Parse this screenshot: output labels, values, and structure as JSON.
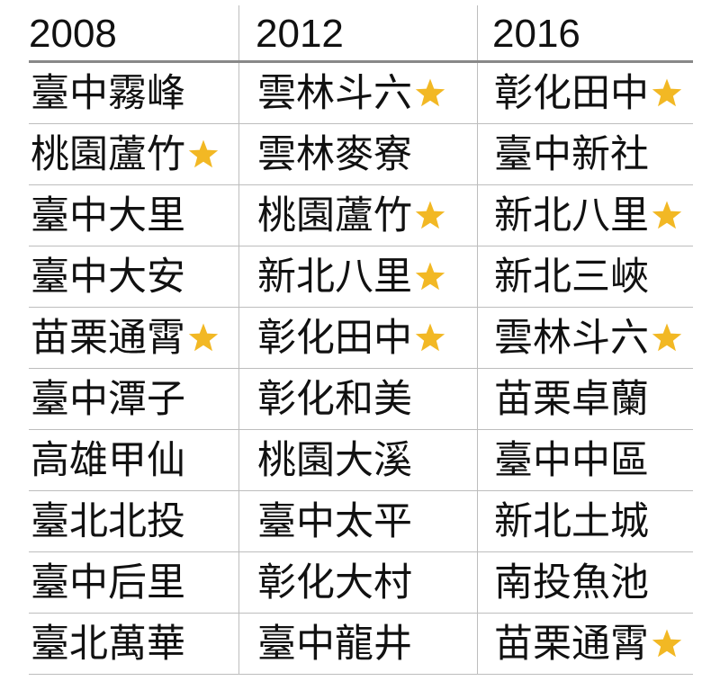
{
  "star_color": "#F2B824",
  "header": [
    "2008",
    "2012",
    "2016"
  ],
  "rows": [
    [
      {
        "text": "臺中霧峰",
        "star": false
      },
      {
        "text": "雲林斗六",
        "star": true
      },
      {
        "text": "彰化田中",
        "star": true
      }
    ],
    [
      {
        "text": "桃園蘆竹",
        "star": true
      },
      {
        "text": "雲林麥寮",
        "star": false
      },
      {
        "text": "臺中新社",
        "star": false
      }
    ],
    [
      {
        "text": "臺中大里",
        "star": false
      },
      {
        "text": "桃園蘆竹",
        "star": true
      },
      {
        "text": "新北八里",
        "star": true
      }
    ],
    [
      {
        "text": "臺中大安",
        "star": false
      },
      {
        "text": "新北八里",
        "star": true
      },
      {
        "text": "新北三峽",
        "star": false
      }
    ],
    [
      {
        "text": "苗栗通霄",
        "star": true
      },
      {
        "text": "彰化田中",
        "star": true
      },
      {
        "text": "雲林斗六",
        "star": true
      }
    ],
    [
      {
        "text": "臺中潭子",
        "star": false
      },
      {
        "text": "彰化和美",
        "star": false
      },
      {
        "text": "苗栗卓蘭",
        "star": false
      }
    ],
    [
      {
        "text": "高雄甲仙",
        "star": false
      },
      {
        "text": "桃園大溪",
        "star": false
      },
      {
        "text": "臺中中區",
        "star": false
      }
    ],
    [
      {
        "text": "臺北北投",
        "star": false
      },
      {
        "text": "臺中太平",
        "star": false
      },
      {
        "text": "新北土城",
        "star": false
      }
    ],
    [
      {
        "text": "臺中后里",
        "star": false
      },
      {
        "text": "彰化大村",
        "star": false
      },
      {
        "text": "南投魚池",
        "star": false
      }
    ],
    [
      {
        "text": "臺北萬華",
        "star": false
      },
      {
        "text": "臺中龍井",
        "star": false
      },
      {
        "text": "苗栗通霄",
        "star": true
      }
    ]
  ]
}
